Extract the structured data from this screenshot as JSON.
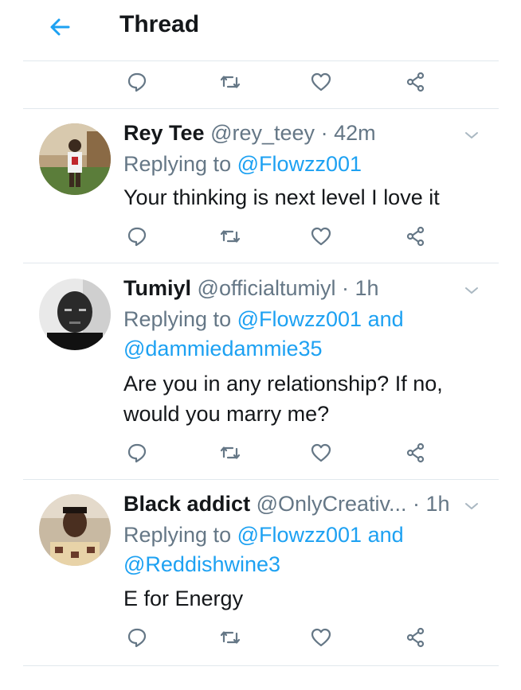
{
  "header": {
    "title": "Thread",
    "back_icon": "back-arrow-icon"
  },
  "colors": {
    "accent": "#1da1f2",
    "secondary_text": "#657786",
    "divider": "#e1e8ed"
  },
  "tweets": [
    {
      "name": "Rey Tee",
      "handle": "@rey_teey",
      "dot": "·",
      "time": "42m",
      "reply_prefix": "Replying to",
      "mention1": "@Flowzz001",
      "and": "",
      "mention2": "",
      "text": "Your thinking is next level I love it"
    },
    {
      "name": "Tumiyl",
      "handle": "@officialtumiyl",
      "dot": "·",
      "time": "1h",
      "reply_prefix": "Replying to",
      "mention1": "@Flowzz001",
      "and": "and",
      "mention2": "@dammiedammie35",
      "text": "Are you in any relationship? If no, would you marry me?"
    },
    {
      "name": "Black addict",
      "handle": "@OnlyCreativ...",
      "dot": "·",
      "time": "1h",
      "reply_prefix": "Replying to",
      "mention1": "@Flowzz001",
      "and": "and",
      "mention2": "@Reddishwine3",
      "text": "E for Energy"
    }
  ]
}
